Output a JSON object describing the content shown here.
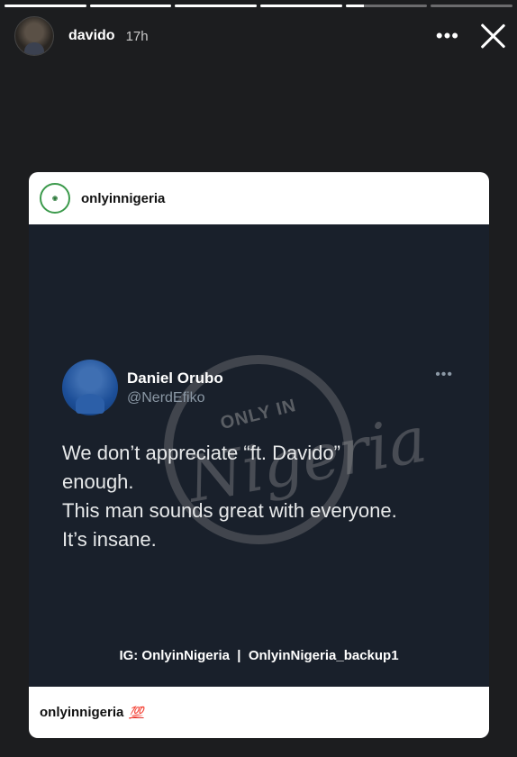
{
  "story": {
    "progress": [
      1,
      1,
      1,
      1,
      0.22,
      0
    ],
    "username": "davido",
    "time": "17h",
    "more_label": "•••"
  },
  "post": {
    "account": "onlyinnigeria",
    "logo_text": "ONLY IN Nigeria",
    "watermark_top": "ONLY IN",
    "watermark_script": "Nigeria",
    "tweet": {
      "name": "Daniel Orubo",
      "handle": "@NerdEfiko",
      "more_label": "•••",
      "lines": [
        "We don’t appreciate “ft. Davido”",
        "enough.",
        "This man sounds great with everyone.",
        "It’s insane."
      ]
    },
    "credit": "IG: OnlyinNigeria  |  OnlyinNigeria_backup1",
    "caption_user": "onlyinnigeria",
    "caption_emoji": "💯"
  },
  "colors": {
    "background": "#1c1d1f",
    "tweet_bg": "#19202b",
    "brand_green": "#3c9a4c",
    "hundred_red": "#e0322d"
  }
}
